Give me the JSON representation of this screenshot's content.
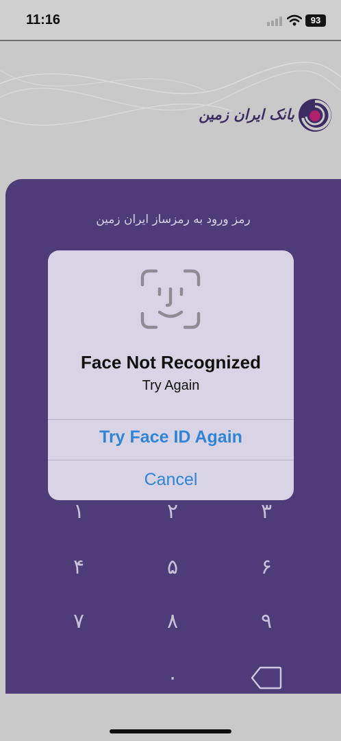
{
  "status_bar": {
    "time": "11:16",
    "battery": "93",
    "icons": [
      "signal-icon",
      "wifi-icon",
      "battery-icon"
    ]
  },
  "header": {
    "bank_name": "بانک ایران زمین",
    "logo_icon": "bank-logo-icon"
  },
  "passcode": {
    "title": "رمز ورود به رمزساز ایران زمین",
    "keys": [
      "۱",
      "۲",
      "۳",
      "۴",
      "۵",
      "۶",
      "۷",
      "۸",
      "۹",
      "۰"
    ],
    "delete_icon": "delete-key-icon"
  },
  "alert": {
    "icon": "face-id-icon",
    "title": "Face Not Recognized",
    "message": "Try Again",
    "primary_button": "Try Face ID Again",
    "cancel_button": "Cancel"
  },
  "colors": {
    "panel": "#4d3c78",
    "alert_background": "#d8d4e6",
    "alert_button": "#2f84d6",
    "brand": "#3d2c62",
    "logo_accent": "#b0206c"
  }
}
